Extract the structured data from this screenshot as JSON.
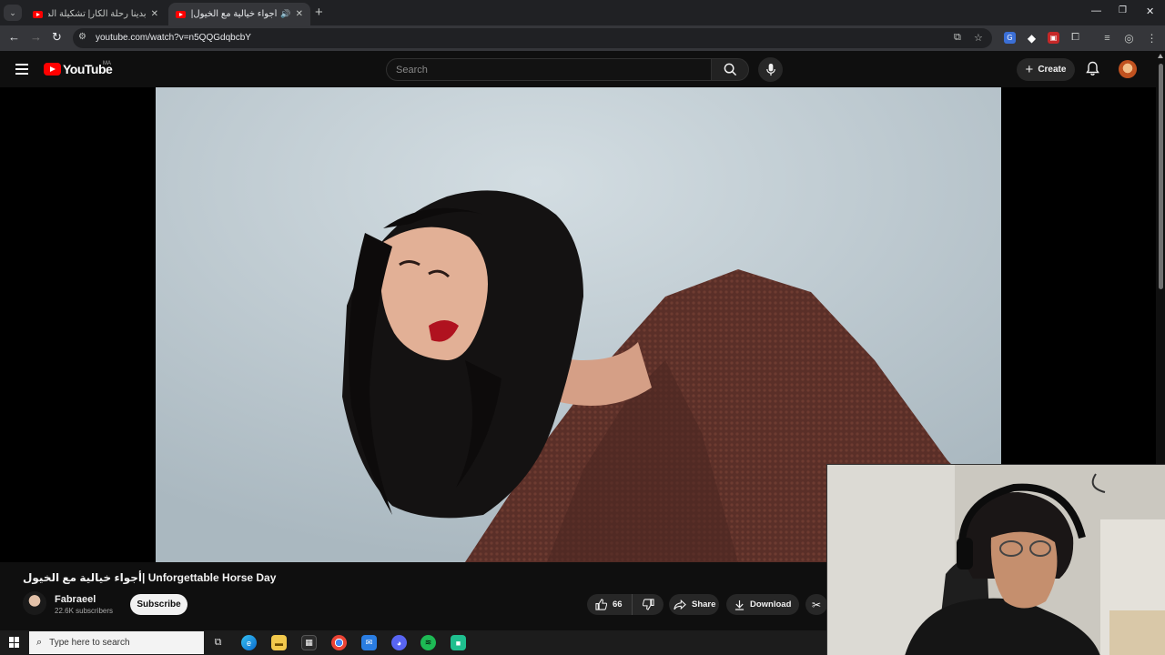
{
  "browser": {
    "tabs": [
      {
        "title": "بدينا رحلة الكار| تشكيلة المنتخب",
        "active": false
      },
      {
        "title": "أجواء خيالية مع الخيول| YouTube",
        "active": true
      }
    ],
    "url": "youtube.com/watch?v=n5QQGdqbcbY"
  },
  "masthead": {
    "logo_text": "YouTube",
    "country_code": "MA",
    "search_placeholder": "Search",
    "create_label": "Create"
  },
  "video": {
    "title": "أجواء خيالية مع الخيول| Unforgettable Horse Day",
    "channel_name": "Fabraeel",
    "subscribers": "22.6K subscribers",
    "subscribe_label": "Subscribe",
    "likes": "66",
    "share_label": "Share",
    "download_label": "Download"
  },
  "taskbar": {
    "search_placeholder": "Type here to search"
  },
  "colors": {
    "youtube_red": "#ff0000",
    "page_bg": "#0f0f0f",
    "pill_bg": "#272727",
    "taskbar_bg": "#1c1c1c"
  }
}
